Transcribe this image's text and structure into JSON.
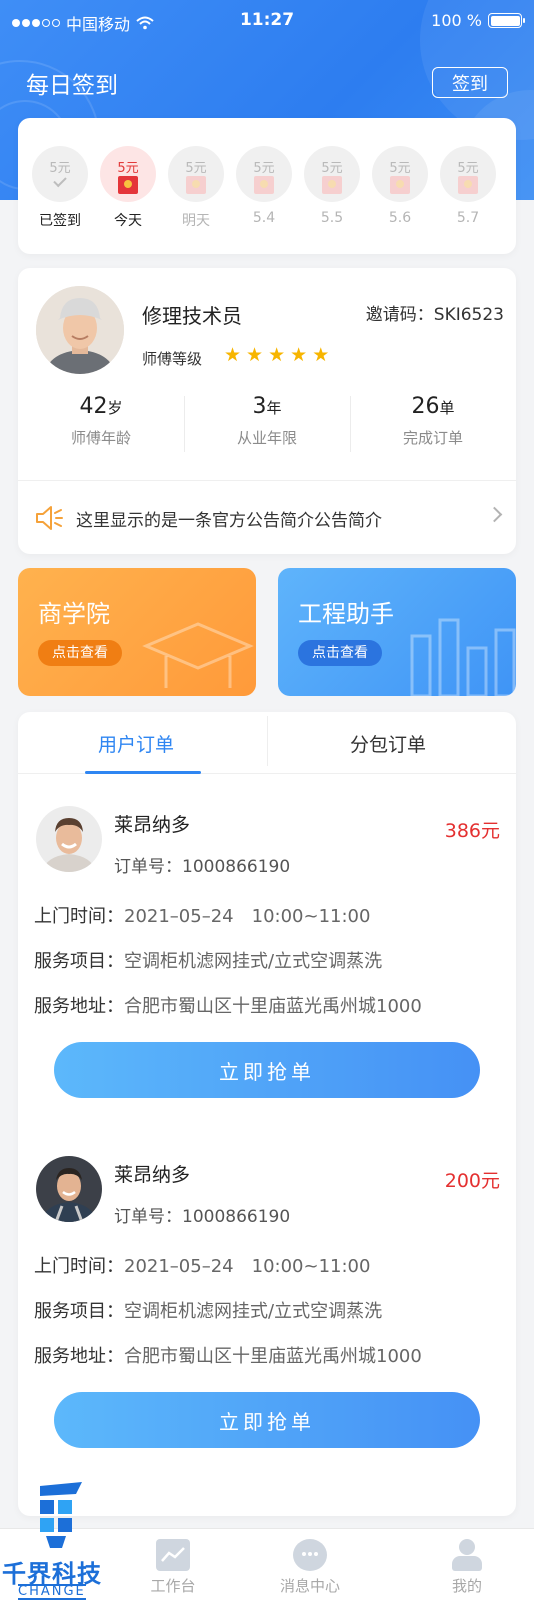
{
  "status_bar": {
    "carrier": "中国移动",
    "time": "11:27",
    "battery": "100 %"
  },
  "header": {
    "title": "每日签到",
    "signin_label": "签到"
  },
  "checkin_days": [
    {
      "amount": "5元",
      "label": "已签到",
      "state": "done"
    },
    {
      "amount": "5元",
      "label": "今天",
      "state": "today"
    },
    {
      "amount": "5元",
      "label": "明天",
      "state": "future"
    },
    {
      "amount": "5元",
      "label": "5.4",
      "state": "future"
    },
    {
      "amount": "5元",
      "label": "5.5",
      "state": "future"
    },
    {
      "amount": "5元",
      "label": "5.6",
      "state": "future"
    },
    {
      "amount": "5元",
      "label": "5.7",
      "state": "future"
    }
  ],
  "profile": {
    "name": "修理技术员",
    "invite_code": "邀请码：SKI6523",
    "level_label": "师傅等级",
    "stars": 5,
    "stats": [
      {
        "value": "42",
        "unit": "岁",
        "label": "师傅年龄"
      },
      {
        "value": "3",
        "unit": "年",
        "label": "从业年限"
      },
      {
        "value": "26",
        "unit": "单",
        "label": "完成订单"
      }
    ],
    "notice": "这里显示的是一条官方公告简介公告简介"
  },
  "tiles": [
    {
      "title": "商学院",
      "button": "点击查看"
    },
    {
      "title": "工程助手",
      "button": "点击查看"
    }
  ],
  "order_tabs": {
    "active": "用户订单",
    "inactive": "分包订单"
  },
  "orders": [
    {
      "customer": "莱昂纳多",
      "price": "386元",
      "order_no": "订单号：1000866190",
      "visit_label": "上门时间：",
      "visit_value": "2021–05–24　10:00~11:00",
      "service_label": "服务项目：",
      "service_value": "空调柜机滤网挂式/立式空调蒸洗",
      "address_label": "服务地址：",
      "address_value": "合肥市蜀山区十里庙蓝光禹州城1000",
      "button": "立即抢单"
    },
    {
      "customer": "莱昂纳多",
      "price": "200元",
      "order_no": "订单号：1000866190",
      "visit_label": "上门时间：",
      "visit_value": "2021–05–24　10:00~11:00",
      "service_label": "服务项目：",
      "service_value": "空调柜机滤网挂式/立式空调蒸洗",
      "address_label": "服务地址：",
      "address_value": "合肥市蜀山区十里庙蓝光禹州城1000",
      "button": "立即抢单"
    }
  ],
  "tabbar": [
    {
      "label": "工作台",
      "icon": "chart-icon"
    },
    {
      "label": "消息中心",
      "icon": "message-icon"
    },
    {
      "label": "我的",
      "icon": "user-icon"
    }
  ],
  "watermark": {
    "text": "千界科技",
    "sub": "CHANGE"
  },
  "colors": {
    "primary": "#2f86f2",
    "price": "#e43030",
    "orange": "#ff9a3a",
    "star": "#f7b500"
  }
}
